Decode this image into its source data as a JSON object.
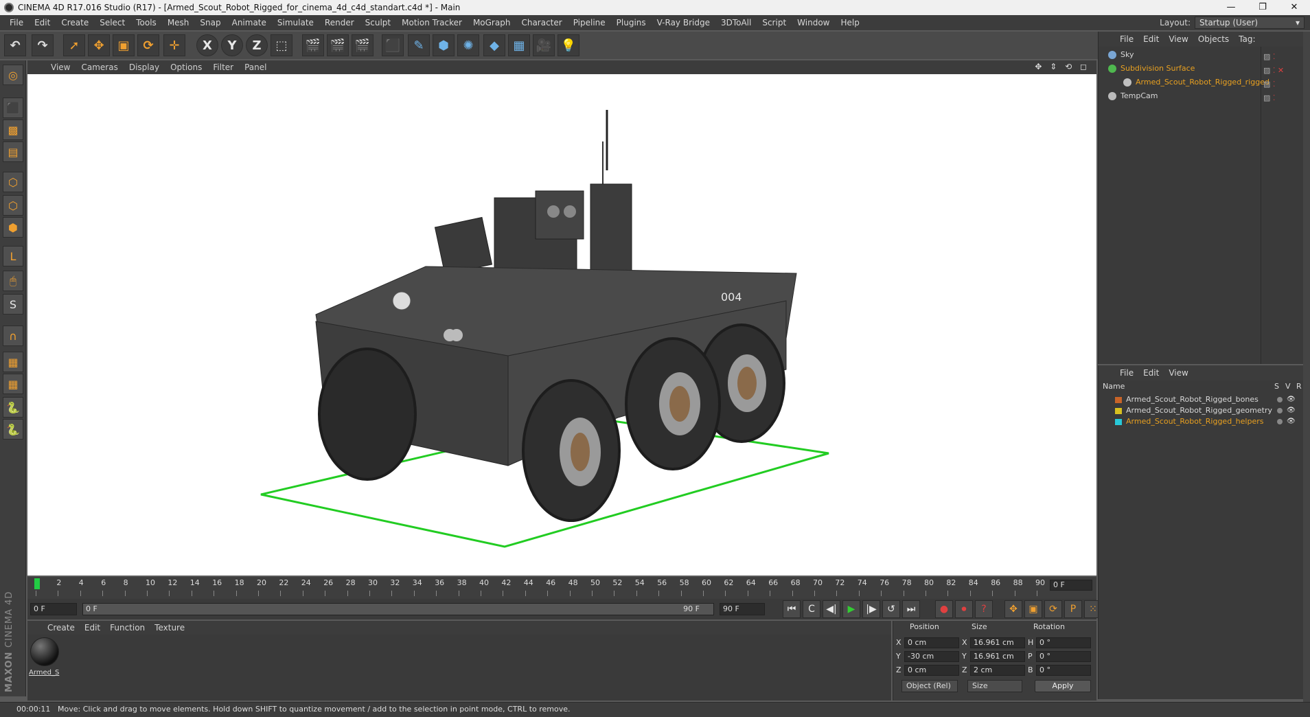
{
  "window": {
    "title": "CINEMA 4D R17.016 Studio (R17) - [Armed_Scout_Robot_Rigged_for_cinema_4d_c4d_standart.c4d *] - Main",
    "controls": [
      "—",
      "❐",
      "✕"
    ]
  },
  "menubar": {
    "items": [
      "File",
      "Edit",
      "Create",
      "Select",
      "Tools",
      "Mesh",
      "Snap",
      "Animate",
      "Simulate",
      "Render",
      "Sculpt",
      "Motion Tracker",
      "MoGraph",
      "Character",
      "Pipeline",
      "Plugins",
      "V-Ray Bridge",
      "3DToAll",
      "Script",
      "Window",
      "Help"
    ],
    "layout_label": "Layout:",
    "layout_value": "Startup (User)"
  },
  "toolbar": {
    "icons": [
      "undo-icon",
      "redo-icon",
      "select-cursor-icon",
      "move-icon",
      "scale-icon",
      "rotate-icon",
      "transform-icon",
      "x-axis-icon",
      "y-axis-icon",
      "z-axis-icon",
      "coordinate-system-icon",
      "render-view-icon",
      "render-picture-viewer-icon",
      "render-settings-icon",
      "cube-icon",
      "pen-spline-icon",
      "subdivision-icon",
      "array-icon",
      "deformer-icon",
      "floor-icon",
      "camera-icon",
      "light-icon"
    ],
    "glyphs": [
      "↶",
      "↷",
      "➚",
      "✥",
      "▣",
      "⟳",
      "✛",
      "X",
      "Y",
      "Z",
      "⬚",
      "🎬",
      "🎬",
      "🎬",
      "⬛",
      "✎",
      "⬢",
      "✺",
      "◆",
      "▦",
      "🎥",
      "💡"
    ]
  },
  "leftpalette": {
    "icons": [
      "make-editable-icon",
      "model-mode-icon",
      "texture-mode-icon",
      "workplane-icon",
      "points-mode-icon",
      "edges-mode-icon",
      "polygons-mode-icon",
      "axis-mode-icon",
      "tweak-mode-icon",
      "solo-icon",
      "snap-magnet-icon",
      "lock-workplane-icon",
      "planar-workplane-icon",
      "python-icon",
      "python-icon-2"
    ],
    "glyphs": [
      "◎",
      "⬛",
      "▩",
      "▤",
      "⬡",
      "⬡",
      "⬢",
      "L",
      "🖱",
      "S",
      "∩",
      "▦",
      "▦",
      "🐍",
      "🐍"
    ],
    "brand_line1": "MAXON",
    "brand_line2": "CINEMA 4D"
  },
  "viewport": {
    "menu": [
      "View",
      "Cameras",
      "Display",
      "Options",
      "Filter",
      "Panel"
    ],
    "nav": "✥ ⇕ ⟲ ◻",
    "vehicle_marking": "004"
  },
  "timeline": {
    "ticks": [
      "0",
      "2",
      "4",
      "6",
      "8",
      "10",
      "12",
      "14",
      "16",
      "18",
      "20",
      "22",
      "24",
      "26",
      "28",
      "30",
      "32",
      "34",
      "36",
      "38",
      "40",
      "42",
      "44",
      "46",
      "48",
      "50",
      "52",
      "54",
      "56",
      "58",
      "60",
      "62",
      "64",
      "66",
      "68",
      "70",
      "72",
      "74",
      "76",
      "78",
      "80",
      "82",
      "84",
      "86",
      "88",
      "90"
    ],
    "current_frame": "0 F"
  },
  "transport": {
    "start_field": "0 F",
    "range_start": "0 F",
    "range_end": "90 F",
    "end_field": "90 F",
    "buttons": [
      "⏮",
      "C",
      "◀|",
      "▶",
      "|▶",
      "↺",
      "⏭"
    ],
    "button_names": [
      "goto-start-icon",
      "prev-key-icon",
      "prev-frame-icon",
      "play-icon",
      "next-frame-icon",
      "loop-icon",
      "goto-end-icon"
    ],
    "key_buttons": [
      "●",
      "⏺",
      "?",
      "✥",
      "▣",
      "⟳",
      "P",
      "⁙",
      "▤"
    ],
    "key_button_names": [
      "record-icon",
      "autokey-icon",
      "keyframe-selection-icon",
      "key-position-icon",
      "key-scale-icon",
      "key-rotation-icon",
      "key-parameter-icon",
      "key-pla-icon",
      "timeline-icon"
    ]
  },
  "material_manager": {
    "menu": [
      "Create",
      "Edit",
      "Function",
      "Texture"
    ],
    "material_label": "Armed_S"
  },
  "coordinates": {
    "headers": [
      "Position",
      "Size",
      "Rotation"
    ],
    "rows": [
      {
        "axis": "X",
        "pos": "0 cm",
        "size_axis": "X",
        "size": "16.961 cm",
        "rot_axis": "H",
        "rot": "0 °"
      },
      {
        "axis": "Y",
        "pos": "-30 cm",
        "size_axis": "Y",
        "size": "16.961 cm",
        "rot_axis": "P",
        "rot": "0 °"
      },
      {
        "axis": "Z",
        "pos": "0 cm",
        "size_axis": "Z",
        "size": "2 cm",
        "rot_axis": "B",
        "rot": "0 °"
      }
    ],
    "mode_dropdown": "Object (Rel)",
    "size_dropdown": "Size",
    "apply_label": "Apply"
  },
  "object_manager": {
    "menu": [
      "File",
      "Edit",
      "View",
      "Objects",
      "Tag:"
    ],
    "objects": [
      {
        "name": "Sky",
        "color": "#d8d8d8",
        "icon_color": "#7aa6d4"
      },
      {
        "name": "Subdivision Surface",
        "color": "#e8a020",
        "icon_color": "#4fb84f"
      },
      {
        "name": "Armed_Scout_Robot_Rigged_rigged",
        "color": "#e8a020",
        "icon_color": "#c0c0c0"
      },
      {
        "name": "TempCam",
        "color": "#d8d8d8",
        "icon_color": "#bbbbbb"
      }
    ]
  },
  "layer_manager": {
    "menu": [
      "File",
      "Edit",
      "View"
    ],
    "header_name": "Name",
    "header_flags": [
      "S",
      "V",
      "R"
    ],
    "layers": [
      {
        "name": "Armed_Scout_Robot_Rigged_bones",
        "swatch": "#c86428",
        "color": "#d8d8d8"
      },
      {
        "name": "Armed_Scout_Robot_Rigged_geometry",
        "swatch": "#d8c020",
        "color": "#d8d8d8"
      },
      {
        "name": "Armed_Scout_Robot_Rigged_helpers",
        "swatch": "#28c8d8",
        "color": "#e8a020"
      }
    ]
  },
  "status": {
    "time": "00:00:11",
    "message": "Move: Click and drag to move elements. Hold down SHIFT to quantize movement / add to the selection in point mode, CTRL to remove."
  }
}
